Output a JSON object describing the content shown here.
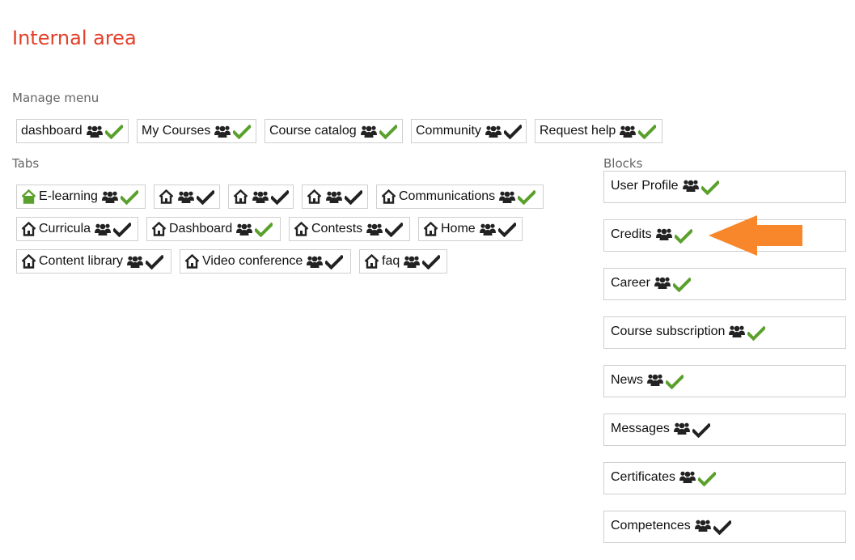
{
  "page": {
    "title": "Internal area"
  },
  "manage_menu": {
    "label": "Manage menu",
    "items": [
      {
        "label": "dashboard",
        "check_color": "#5aa02c"
      },
      {
        "label": "My Courses",
        "check_color": "#5aa02c"
      },
      {
        "label": "Course catalog",
        "check_color": "#5aa02c"
      },
      {
        "label": "Community",
        "check_color": "#222222"
      },
      {
        "label": "Request help",
        "check_color": "#5aa02c"
      }
    ]
  },
  "tabs": {
    "label": "Tabs",
    "items": [
      {
        "label": "E-learning",
        "house_color": "#5aa02c",
        "check_color": "#5aa02c"
      },
      {
        "label": "",
        "house_color": "#222222",
        "check_color": "#222222"
      },
      {
        "label": "",
        "house_color": "#222222",
        "check_color": "#222222"
      },
      {
        "label": "",
        "house_color": "#222222",
        "check_color": "#222222"
      },
      {
        "label": "Communications",
        "house_color": "#222222",
        "check_color": "#5aa02c"
      },
      {
        "label": "Curricula",
        "house_color": "#222222",
        "check_color": "#222222"
      },
      {
        "label": "Dashboard",
        "house_color": "#222222",
        "check_color": "#5aa02c"
      },
      {
        "label": "Contests",
        "house_color": "#222222",
        "check_color": "#222222"
      },
      {
        "label": "Home",
        "house_color": "#222222",
        "check_color": "#222222"
      },
      {
        "label": "Content library",
        "house_color": "#222222",
        "check_color": "#222222"
      },
      {
        "label": "Video conference",
        "house_color": "#222222",
        "check_color": "#222222"
      },
      {
        "label": "faq",
        "house_color": "#222222",
        "check_color": "#222222"
      }
    ]
  },
  "blocks": {
    "label": "Blocks",
    "items": [
      {
        "label": "User Profile",
        "check_color": "#5aa02c"
      },
      {
        "label": "Credits",
        "check_color": "#5aa02c"
      },
      {
        "label": "Career",
        "check_color": "#5aa02c"
      },
      {
        "label": "Course subscription",
        "check_color": "#5aa02c"
      },
      {
        "label": "News",
        "check_color": "#5aa02c"
      },
      {
        "label": "Messages",
        "check_color": "#222222"
      },
      {
        "label": "Certificates",
        "check_color": "#5aa02c"
      },
      {
        "label": "Competences",
        "check_color": "#222222"
      }
    ]
  },
  "annotation": {
    "arrow_color": "#f7872a",
    "arrow_target": "Credits"
  },
  "icons": {
    "users": "users-icon",
    "check": "check-icon",
    "home": "home-icon"
  },
  "colors": {
    "title": "#e2402a",
    "enabled_green": "#5aa02c",
    "default_dark": "#222222"
  }
}
